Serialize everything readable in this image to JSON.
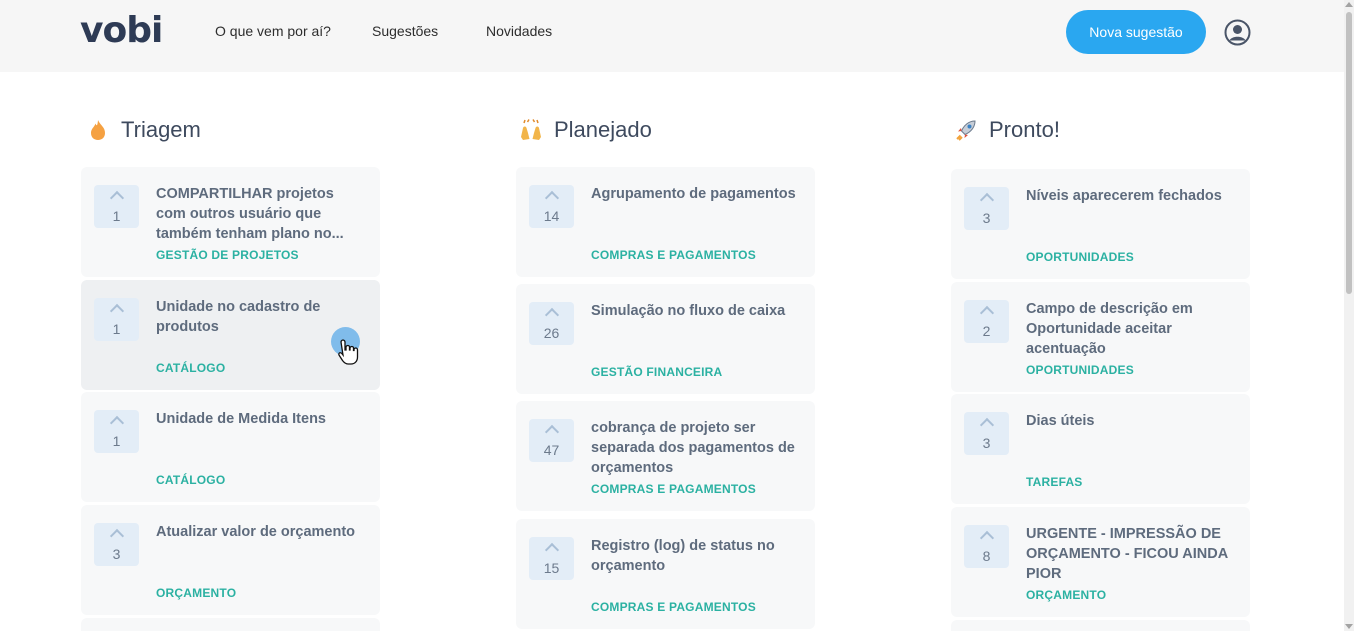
{
  "header": {
    "logo": "vobi",
    "nav": [
      "O que vem por aí?",
      "Sugestões",
      "Novidades"
    ],
    "cta_label": "Nova sugestão"
  },
  "columns": [
    {
      "title": "Triagem",
      "icon": "flame-icon",
      "cards": [
        {
          "votes": "1",
          "title": "COMPARTILHAR projetos com outros usuário que também tenham plano no...",
          "category": "GESTÃO DE PROJETOS"
        },
        {
          "votes": "1",
          "title": "Unidade no cadastro de produtos",
          "category": "CATÁLOGO"
        },
        {
          "votes": "1",
          "title": "Unidade de Medida Itens",
          "category": "CATÁLOGO"
        },
        {
          "votes": "3",
          "title": "Atualizar valor de orçamento",
          "category": "ORÇAMENTO"
        }
      ]
    },
    {
      "title": "Planejado",
      "icon": "raised-hands-icon",
      "cards": [
        {
          "votes": "14",
          "title": "Agrupamento de pagamentos",
          "category": "COMPRAS E PAGAMENTOS"
        },
        {
          "votes": "26",
          "title": "Simulação no fluxo de caixa",
          "category": "GESTÃO FINANCEIRA"
        },
        {
          "votes": "47",
          "title": "cobrança de projeto ser separada dos pagamentos de orçamentos",
          "category": "COMPRAS E PAGAMENTOS"
        },
        {
          "votes": "15",
          "title": "Registro (log) de status no orçamento",
          "category": "COMPRAS E PAGAMENTOS"
        }
      ]
    },
    {
      "title": "Pronto!",
      "icon": "rocket-icon",
      "cards": [
        {
          "votes": "3",
          "title": "Níveis aparecerem fechados",
          "category": "OPORTUNIDADES"
        },
        {
          "votes": "2",
          "title": "Campo de descrição em Oportunidade aceitar acentuação",
          "category": "OPORTUNIDADES"
        },
        {
          "votes": "3",
          "title": "Dias úteis",
          "category": "TAREFAS"
        },
        {
          "votes": "8",
          "title": "URGENTE - IMPRESSÃO DE ORÇAMENTO - FICOU AINDA PIOR",
          "category": "ORÇAMENTO"
        }
      ]
    }
  ],
  "colors": {
    "accent": "#2aa7f0",
    "category": "#2bb1a2",
    "card_bg": "#f7f8f9",
    "vote_bg": "#e3edf7"
  }
}
